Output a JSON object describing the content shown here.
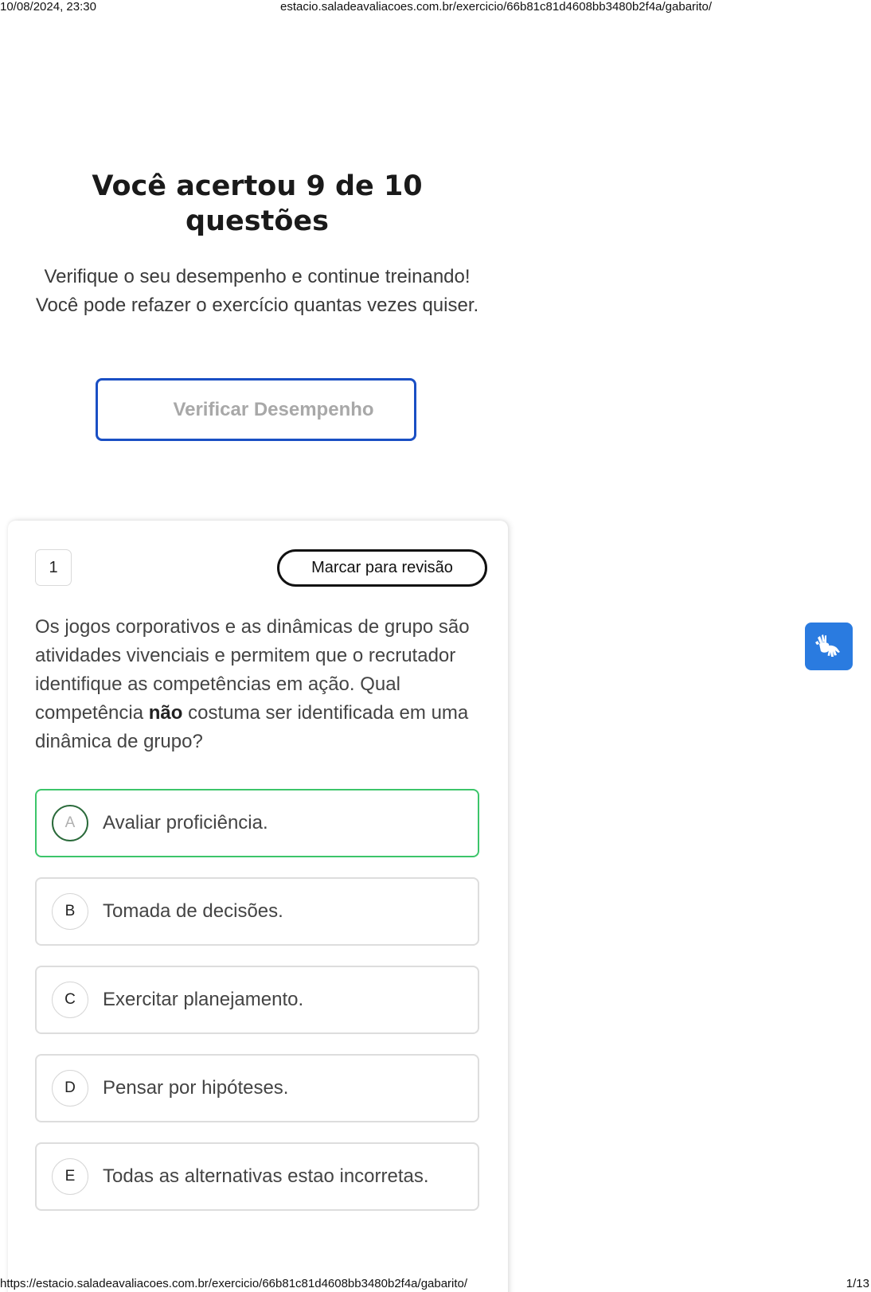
{
  "print_header": {
    "datetime": "10/08/2024, 23:30",
    "page_url": "estacio.saladeavaliacoes.com.br/exercicio/66b81c81d4608bb3480b2f4a/gabarito/"
  },
  "print_footer": {
    "full_url": "https://estacio.saladeavaliacoes.com.br/exercicio/66b81c81d4608bb3480b2f4a/gabarito/",
    "page_count": "1/13"
  },
  "result": {
    "title_line1": "Você acertou 9 de 10",
    "title_line2": "questões",
    "subtitle": "Verifique o seu desempenho e continue treinando! Você pode refazer o exercício quantas vezes quiser.",
    "verify_button_label": "Verificar Desempenho"
  },
  "question": {
    "number": "1",
    "review_button_label": "Marcar para revisão",
    "text_before_bold": "Os jogos corporativos e as dinâmicas de grupo são atividades vivenciais e permitem que o recrutador identifique as competências em ação. Qual competência ",
    "text_bold": "não",
    "text_after_bold": " costuma ser identificada em uma dinâmica de grupo?",
    "options": [
      {
        "letter": "A",
        "text": "Avaliar proficiência.",
        "state": "correct"
      },
      {
        "letter": "B",
        "text": "Tomada de decisões.",
        "state": "default"
      },
      {
        "letter": "C",
        "text": "Exercitar planejamento.",
        "state": "default"
      },
      {
        "letter": "D",
        "text": "Pensar por hipóteses.",
        "state": "default"
      },
      {
        "letter": "E",
        "text": "Todas as alternativas estao incorretas.",
        "state": "default"
      }
    ]
  },
  "accessibility": {
    "icon": "sign-language-icon",
    "color": "#2a7be0"
  },
  "colors": {
    "primary_border": "#1a4fc4",
    "correct_border": "#3cc56a"
  }
}
